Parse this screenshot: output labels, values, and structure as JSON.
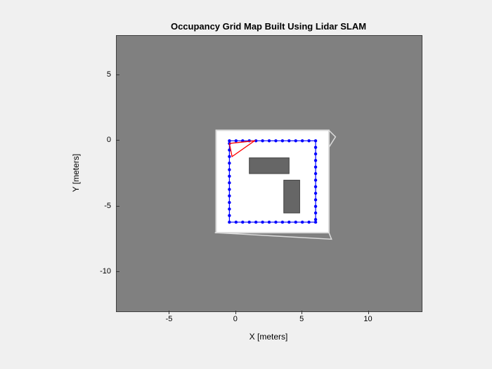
{
  "chart_data": {
    "type": "heatmap",
    "title": "Occupancy Grid Map Built Using Lidar SLAM",
    "xlabel": "X [meters]",
    "ylabel": "Y [meters]",
    "xlim": [
      -9,
      14
    ],
    "ylim": [
      -13,
      8
    ],
    "xticks": [
      -5,
      0,
      5,
      10
    ],
    "yticks": [
      -10,
      -5,
      0,
      5
    ],
    "colors": {
      "unknown": "#808080",
      "free": "#ffffff",
      "occupied": "#666666",
      "boundary": "#dcdcdc",
      "trajectory_line": "#0000ff",
      "trajectory_marker": "#0000ff",
      "pose_indicator": "#ff0000"
    },
    "free_region": {
      "x0": -1.5,
      "x1": 7.0,
      "y0": -7.0,
      "y1": 0.8
    },
    "obstacles": [
      {
        "x0": 1.0,
        "x1": 4.0,
        "y0": -2.5,
        "y1": -1.3
      },
      {
        "x0": 3.6,
        "x1": 4.8,
        "y0": -5.5,
        "y1": -3.0
      }
    ],
    "trajectory": [
      [
        -0.5,
        0.0
      ],
      [
        0.0,
        0.0
      ],
      [
        0.5,
        0.0
      ],
      [
        1.0,
        0.0
      ],
      [
        1.5,
        0.0
      ],
      [
        2.0,
        0.0
      ],
      [
        2.5,
        0.0
      ],
      [
        3.0,
        0.0
      ],
      [
        3.5,
        0.0
      ],
      [
        4.0,
        0.0
      ],
      [
        4.5,
        0.0
      ],
      [
        5.0,
        0.0
      ],
      [
        5.5,
        0.0
      ],
      [
        6.0,
        0.0
      ],
      [
        6.0,
        -0.5
      ],
      [
        6.0,
        -1.0
      ],
      [
        6.0,
        -1.5
      ],
      [
        6.0,
        -2.0
      ],
      [
        6.0,
        -2.5
      ],
      [
        6.0,
        -3.0
      ],
      [
        6.0,
        -3.5
      ],
      [
        6.0,
        -4.0
      ],
      [
        6.0,
        -4.5
      ],
      [
        6.0,
        -5.0
      ],
      [
        6.0,
        -5.5
      ],
      [
        6.0,
        -6.0
      ],
      [
        6.0,
        -6.2
      ],
      [
        5.5,
        -6.2
      ],
      [
        5.0,
        -6.2
      ],
      [
        4.5,
        -6.2
      ],
      [
        4.0,
        -6.2
      ],
      [
        3.5,
        -6.2
      ],
      [
        3.0,
        -6.2
      ],
      [
        2.5,
        -6.2
      ],
      [
        2.0,
        -6.2
      ],
      [
        1.5,
        -6.2
      ],
      [
        1.0,
        -6.2
      ],
      [
        0.5,
        -6.2
      ],
      [
        0.0,
        -6.2
      ],
      [
        -0.5,
        -6.2
      ],
      [
        -0.5,
        -5.7
      ],
      [
        -0.5,
        -5.2
      ],
      [
        -0.5,
        -4.7
      ],
      [
        -0.5,
        -4.2
      ],
      [
        -0.5,
        -3.7
      ],
      [
        -0.5,
        -3.2
      ],
      [
        -0.5,
        -2.7
      ],
      [
        -0.5,
        -2.2
      ],
      [
        -0.5,
        -1.7
      ],
      [
        -0.5,
        -1.2
      ],
      [
        -0.5,
        -0.7
      ],
      [
        -0.5,
        -0.2
      ]
    ],
    "pose_triangle": [
      [
        -0.5,
        -0.2
      ],
      [
        1.4,
        0.0
      ],
      [
        -0.3,
        -1.2
      ],
      [
        -0.5,
        -0.2
      ]
    ],
    "scan_artifacts": [
      [
        [
          -1.6,
          -7.0
        ],
        [
          7.2,
          -7.5
        ],
        [
          7.0,
          -7.0
        ]
      ],
      [
        [
          7.0,
          0.8
        ],
        [
          7.5,
          0.3
        ],
        [
          7.0,
          -0.5
        ]
      ]
    ]
  }
}
